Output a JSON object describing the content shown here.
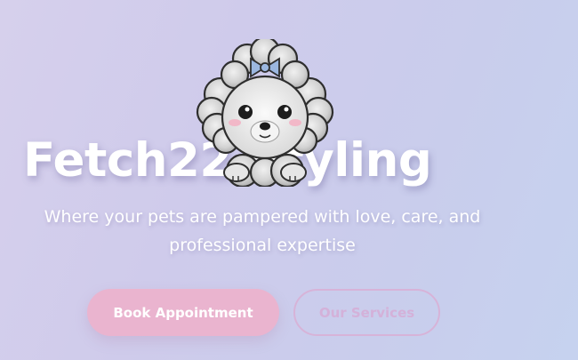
{
  "hero": {
    "title": "Fetch22 Styling",
    "tagline": "Where your pets are pampered with love, care, and professional expertise",
    "mascot_icon": "poodle-mascot-icon",
    "primary_button": "Book Appointment",
    "secondary_button": "Our Services"
  },
  "colors": {
    "primary_button_bg": "#eab4cf",
    "secondary_button_text": "#d4b1d9",
    "bow": "#9bb7e0",
    "cheeks": "#f2b8c8"
  }
}
